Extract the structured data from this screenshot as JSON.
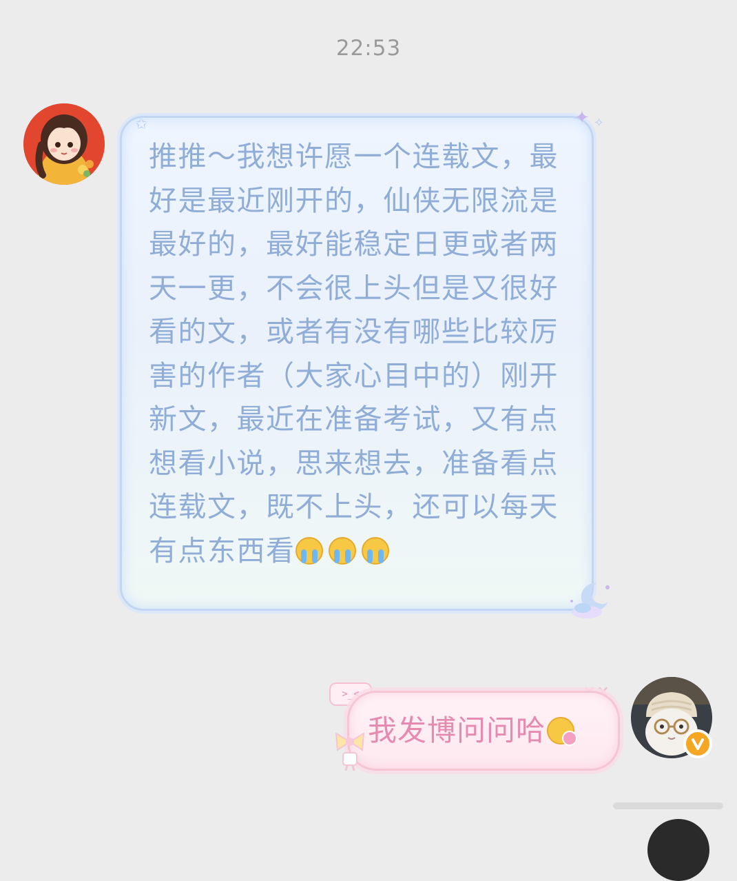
{
  "timestamp": "22:53",
  "messages": [
    {
      "side": "left",
      "avatar_icon": "girl-avatar-icon",
      "text": "推推～我想许愿一个连载文，最好是最近刚开的，仙侠无限流是最好的，最好能稳定日更或者两天一更，不会很上头但是又很好看的文，或者有没有哪些比较厉害的作者（大家心目中的）刚开新文，最近在准备考试，又有点想看小说，思来想去，准备看点连载文，既不上头，还可以每天有点东西看",
      "emojis": [
        "loudly-crying-face-icon",
        "loudly-crying-face-icon",
        "loudly-crying-face-icon"
      ],
      "bubble_border_color": "#c2d6f4",
      "text_color": "#8fadd6"
    },
    {
      "side": "right",
      "avatar_icon": "cat-avatar-icon",
      "badge_icon": "verified-v-badge-icon",
      "text": "我发博问问哈",
      "emojis": [
        "smiling-face-with-flower-icon"
      ],
      "bubble_border_color": "#f5c5d4",
      "text_color": "#e58ab0"
    }
  ],
  "decorations": {
    "tag_text": ">_<"
  },
  "colors": {
    "background": "#ececec",
    "timestamp": "#9a9a9a",
    "badge": "#f5a623"
  }
}
